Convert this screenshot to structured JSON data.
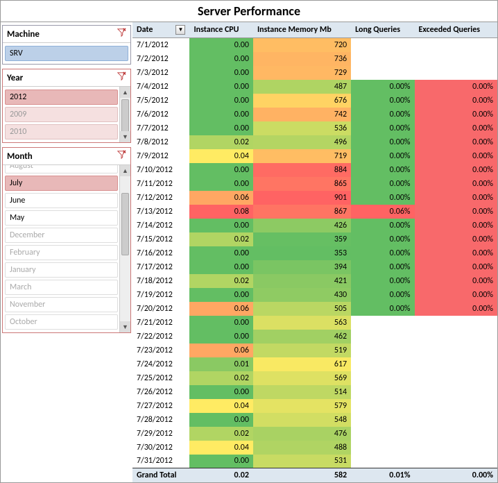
{
  "title": "Server Performance",
  "slicers": {
    "machine": {
      "label": "Machine",
      "items": [
        {
          "label": "SRV",
          "sel": "blue"
        }
      ]
    },
    "year": {
      "label": "Year",
      "items": [
        {
          "label": "2012",
          "sel": "red"
        },
        {
          "label": "2009",
          "sel": "availred"
        },
        {
          "label": "2010",
          "sel": "availred"
        }
      ]
    },
    "month": {
      "label": "Month",
      "items": [
        {
          "label": "August",
          "sel": "dim"
        },
        {
          "label": "July",
          "sel": "red"
        },
        {
          "label": "June",
          "sel": ""
        },
        {
          "label": "May",
          "sel": ""
        },
        {
          "label": "December",
          "sel": "dim"
        },
        {
          "label": "February",
          "sel": "dim"
        },
        {
          "label": "January",
          "sel": "dim"
        },
        {
          "label": "March",
          "sel": "dim"
        },
        {
          "label": "November",
          "sel": "dim"
        },
        {
          "label": "October",
          "sel": "dim"
        }
      ]
    }
  },
  "columns": {
    "date": "Date",
    "cpu": "Instance CPU",
    "mem": "Instance Memory Mb",
    "long": "Long Queries",
    "exc": "Exceeded Queries"
  },
  "rows": [
    {
      "date": "7/1/2012",
      "cpu": "0.00",
      "mem": "720",
      "long": "",
      "exc": ""
    },
    {
      "date": "7/2/2012",
      "cpu": "0.00",
      "mem": "736",
      "long": "",
      "exc": ""
    },
    {
      "date": "7/3/2012",
      "cpu": "0.00",
      "mem": "729",
      "long": "",
      "exc": ""
    },
    {
      "date": "7/4/2012",
      "cpu": "0.00",
      "mem": "487",
      "long": "0.00%",
      "exc": "0.00%"
    },
    {
      "date": "7/5/2012",
      "cpu": "0.00",
      "mem": "676",
      "long": "0.00%",
      "exc": "0.00%"
    },
    {
      "date": "7/6/2012",
      "cpu": "0.00",
      "mem": "742",
      "long": "0.00%",
      "exc": "0.00%"
    },
    {
      "date": "7/7/2012",
      "cpu": "0.00",
      "mem": "536",
      "long": "0.00%",
      "exc": "0.00%"
    },
    {
      "date": "7/8/2012",
      "cpu": "0.02",
      "mem": "496",
      "long": "0.00%",
      "exc": "0.00%"
    },
    {
      "date": "7/9/2012",
      "cpu": "0.04",
      "mem": "719",
      "long": "0.00%",
      "exc": "0.00%"
    },
    {
      "date": "7/10/2012",
      "cpu": "0.00",
      "mem": "884",
      "long": "0.00%",
      "exc": "0.00%"
    },
    {
      "date": "7/11/2012",
      "cpu": "0.00",
      "mem": "865",
      "long": "0.00%",
      "exc": "0.00%"
    },
    {
      "date": "7/12/2012",
      "cpu": "0.06",
      "mem": "901",
      "long": "0.00%",
      "exc": "0.00%"
    },
    {
      "date": "7/13/2012",
      "cpu": "0.08",
      "mem": "867",
      "long": "0.06%",
      "exc": "0.00%"
    },
    {
      "date": "7/14/2012",
      "cpu": "0.00",
      "mem": "426",
      "long": "0.00%",
      "exc": "0.00%"
    },
    {
      "date": "7/15/2012",
      "cpu": "0.02",
      "mem": "359",
      "long": "0.00%",
      "exc": "0.00%"
    },
    {
      "date": "7/16/2012",
      "cpu": "0.00",
      "mem": "353",
      "long": "0.00%",
      "exc": "0.00%"
    },
    {
      "date": "7/17/2012",
      "cpu": "0.00",
      "mem": "394",
      "long": "0.00%",
      "exc": "0.00%"
    },
    {
      "date": "7/18/2012",
      "cpu": "0.02",
      "mem": "421",
      "long": "0.00%",
      "exc": "0.00%"
    },
    {
      "date": "7/19/2012",
      "cpu": "0.00",
      "mem": "430",
      "long": "0.00%",
      "exc": "0.00%"
    },
    {
      "date": "7/20/2012",
      "cpu": "0.06",
      "mem": "505",
      "long": "0.00%",
      "exc": "0.00%"
    },
    {
      "date": "7/21/2012",
      "cpu": "0.00",
      "mem": "563",
      "long": "",
      "exc": ""
    },
    {
      "date": "7/22/2012",
      "cpu": "0.00",
      "mem": "462",
      "long": "",
      "exc": ""
    },
    {
      "date": "7/23/2012",
      "cpu": "0.06",
      "mem": "519",
      "long": "",
      "exc": ""
    },
    {
      "date": "7/24/2012",
      "cpu": "0.01",
      "mem": "617",
      "long": "",
      "exc": ""
    },
    {
      "date": "7/25/2012",
      "cpu": "0.02",
      "mem": "569",
      "long": "",
      "exc": ""
    },
    {
      "date": "7/26/2012",
      "cpu": "0.00",
      "mem": "514",
      "long": "",
      "exc": ""
    },
    {
      "date": "7/27/2012",
      "cpu": "0.04",
      "mem": "579",
      "long": "",
      "exc": ""
    },
    {
      "date": "7/28/2012",
      "cpu": "0.00",
      "mem": "548",
      "long": "",
      "exc": ""
    },
    {
      "date": "7/29/2012",
      "cpu": "0.02",
      "mem": "476",
      "long": "",
      "exc": ""
    },
    {
      "date": "7/30/2012",
      "cpu": "0.04",
      "mem": "488",
      "long": "",
      "exc": ""
    },
    {
      "date": "7/31/2012",
      "cpu": "0.00",
      "mem": "531",
      "long": "",
      "exc": ""
    }
  ],
  "total": {
    "label": "Grand Total",
    "cpu": "0.02",
    "mem": "582",
    "long": "0.01%",
    "exc": "0.00%"
  },
  "chart_data": {
    "type": "table",
    "title": "Server Performance",
    "columns": [
      "Date",
      "Instance CPU",
      "Instance Memory Mb",
      "Long Queries",
      "Exceeded Queries"
    ],
    "cpu_range": [
      0.0,
      0.08
    ],
    "mem_range": [
      353,
      901
    ],
    "long_range": [
      0.0,
      0.06
    ],
    "exc_range": [
      0.0,
      0.0
    ],
    "color_scale": "green-yellow-red"
  }
}
